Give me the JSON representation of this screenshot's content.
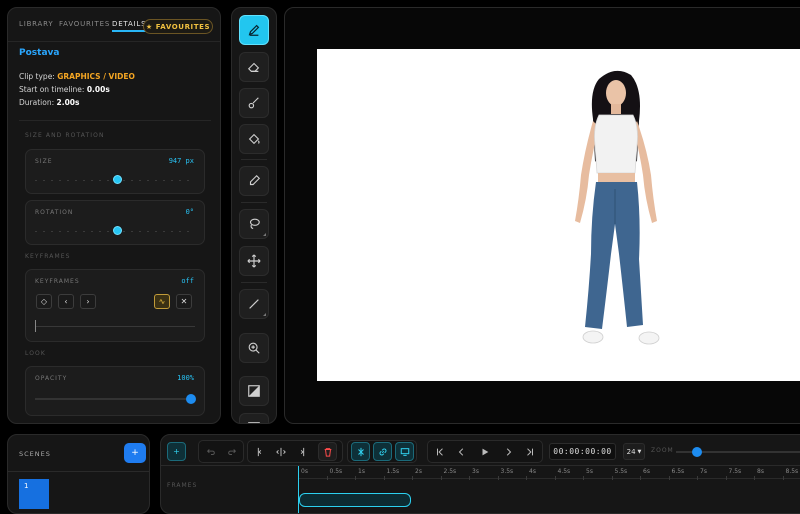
{
  "left_panel": {
    "tabs": [
      {
        "label": "LIBRARY"
      },
      {
        "label": "FAVOURITES"
      },
      {
        "label": "DETAILS"
      }
    ],
    "favourites_button": "FAVOURITES",
    "clip_name": "Postava",
    "clip_type_label": "Clip type:",
    "clip_type_value": "GRAPHICS / VIDEO",
    "start_label": "Start on timeline:",
    "start_value": "0.00s",
    "duration_label": "Duration:",
    "duration_value": "2.00s",
    "size_rotation_section": "SIZE AND ROTATION",
    "size": {
      "label": "SIZE",
      "value": "947 px",
      "level": 0.5
    },
    "rotation": {
      "label": "ROTATION",
      "value": "0°",
      "level": 0.5
    },
    "keyframes_section": "KEYFRAMES",
    "keyframes": {
      "label": "KEYFRAMES",
      "state": "off"
    },
    "look_section": "LOOK",
    "opacity": {
      "label": "OPACITY",
      "value": "100%",
      "level": 1.0
    }
  },
  "toolbar": {
    "tools": [
      "pen-tool",
      "eraser-tool",
      "brush-tool",
      "fill-tool",
      "eyedropper-tool",
      "lasso-tool",
      "move-tool",
      "line-tool",
      "zoom-tool",
      "gradient-tool",
      "panel-tool"
    ],
    "active_tool": "pen-tool"
  },
  "scenes": {
    "label": "SCENES",
    "add_label": "+",
    "items": [
      {
        "number": "1"
      }
    ]
  },
  "timeline": {
    "add_label": "+",
    "timecode": "00:00:00:00",
    "fps": "24",
    "zoom_label": "ZOOM",
    "zoom_level": 0.1,
    "frames_label": "FRAMES",
    "ruler_ticks": [
      "0s",
      "0.5s",
      "1s",
      "1.5s",
      "2s",
      "2.5s",
      "3s",
      "3.5s",
      "4s",
      "4.5s",
      "5s",
      "5.5s",
      "6s",
      "6.5s",
      "7s",
      "7.5s",
      "8s",
      "8.5s"
    ]
  },
  "colors": {
    "accent_teal": "#22c6ef",
    "accent_blue": "#1f7cf0",
    "clip_name_blue": "#2aa7ff",
    "clip_type_orange": "#f5a623",
    "favourites_gold": "#f0c040"
  }
}
